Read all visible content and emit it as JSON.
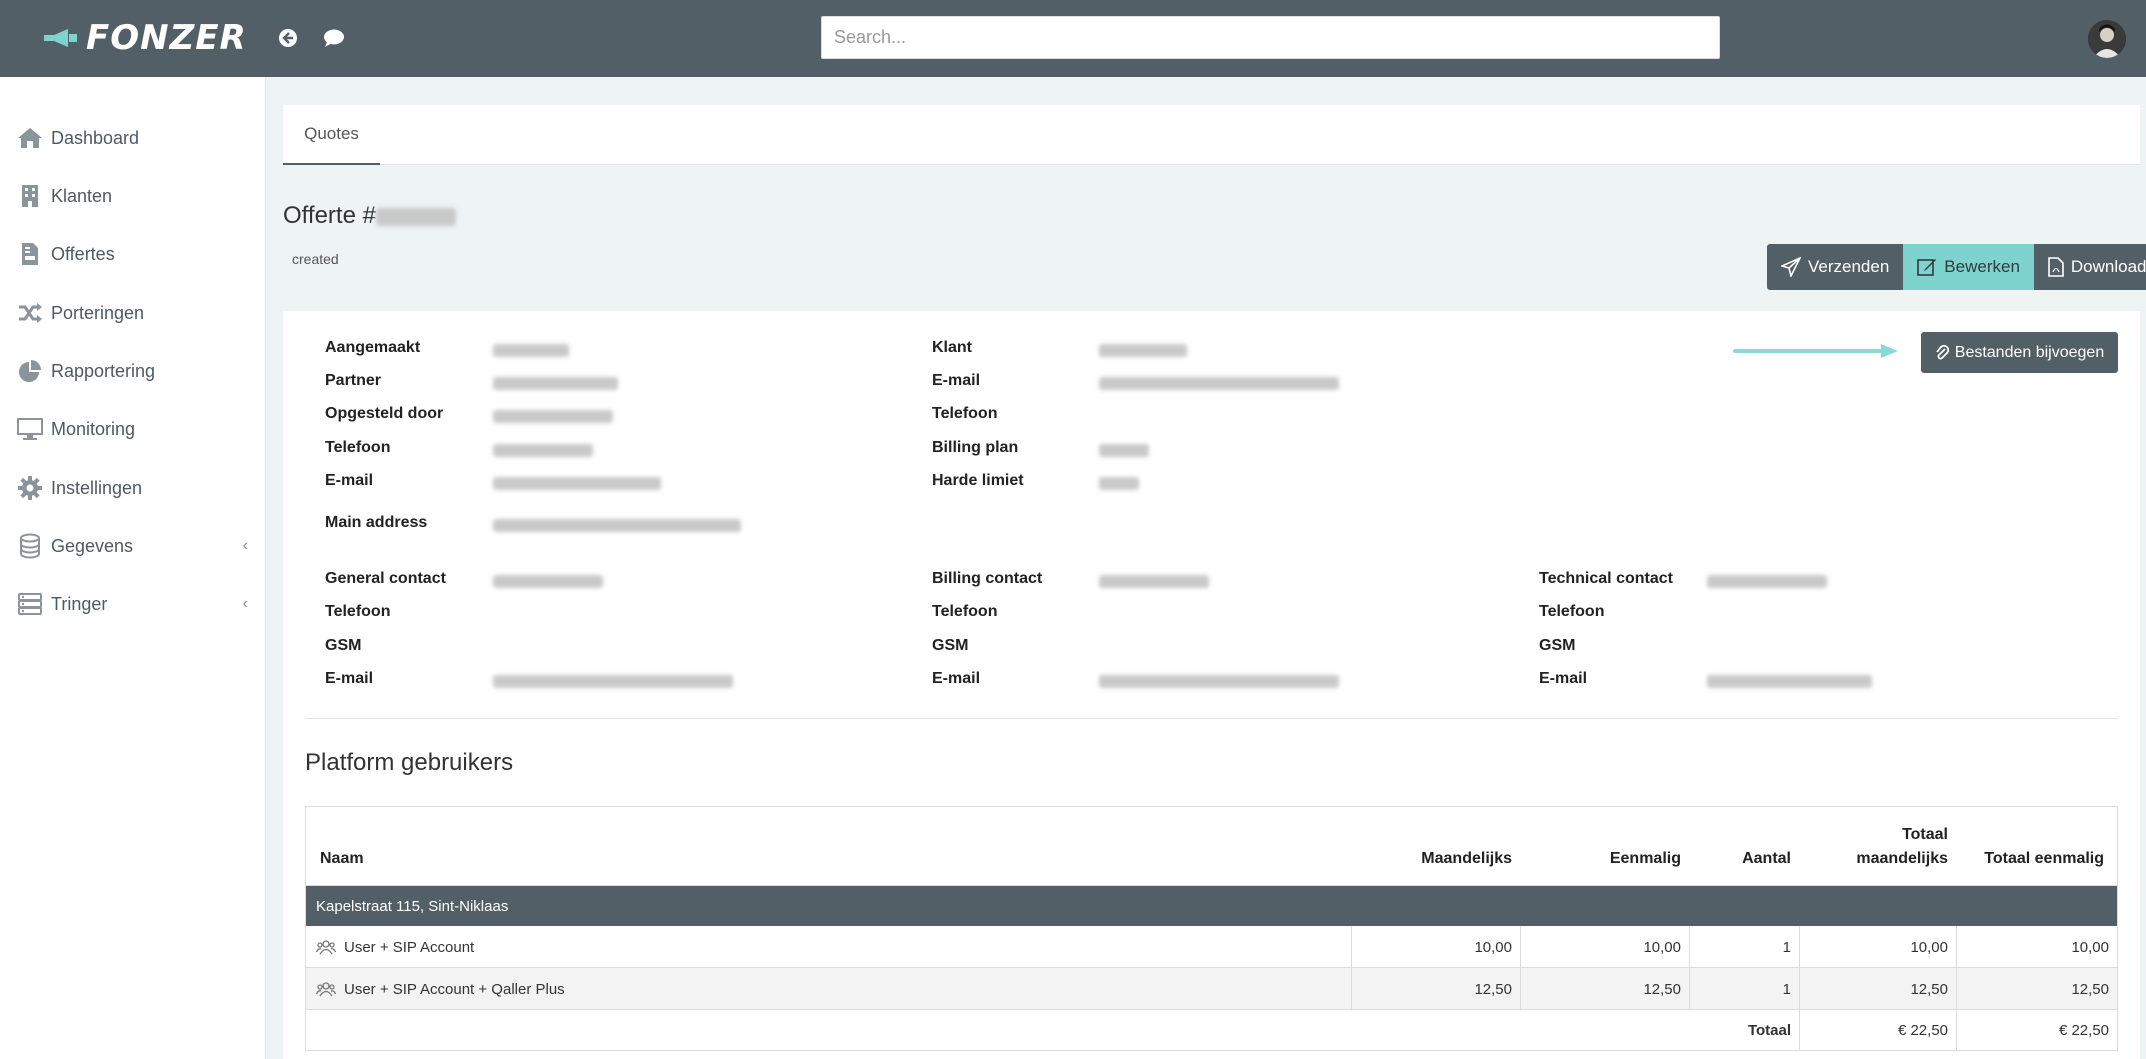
{
  "header": {
    "logo_text": "FONZER",
    "search_placeholder": "Search..."
  },
  "sidebar": {
    "items": [
      {
        "label": "Dashboard",
        "icon": "home-icon"
      },
      {
        "label": "Klanten",
        "icon": "building-icon"
      },
      {
        "label": "Offertes",
        "icon": "file-invoice-icon"
      },
      {
        "label": "Porteringen",
        "icon": "shuffle-icon"
      },
      {
        "label": "Rapportering",
        "icon": "pie-chart-icon"
      },
      {
        "label": "Monitoring",
        "icon": "monitor-icon"
      },
      {
        "label": "Instellingen",
        "icon": "gear-icon"
      },
      {
        "label": "Gegevens",
        "icon": "database-icon"
      },
      {
        "label": "Tringer",
        "icon": "server-icon"
      }
    ]
  },
  "tabs": [
    {
      "label": "Quotes"
    }
  ],
  "quote": {
    "title_prefix": "Offerte #",
    "status": "created"
  },
  "actions": {
    "send": "Verzenden",
    "edit": "Bewerken",
    "download": "Download",
    "attach": "Bestanden bijvoegen"
  },
  "details": {
    "col1": [
      "Aangemaakt",
      "Partner",
      "Opgesteld door",
      "Telefoon",
      "E-mail"
    ],
    "main_address": "Main address",
    "col2": [
      "Klant",
      "E-mail",
      "Telefoon",
      "Billing plan",
      "Harde limiet"
    ]
  },
  "contacts": [
    {
      "title": "General contact",
      "fields": [
        "Telefoon",
        "GSM",
        "E-mail"
      ]
    },
    {
      "title": "Billing contact",
      "fields": [
        "Telefoon",
        "GSM",
        "E-mail"
      ]
    },
    {
      "title": "Technical contact",
      "fields": [
        "Telefoon",
        "GSM",
        "E-mail"
      ]
    }
  ],
  "platform": {
    "title": "Platform gebruikers",
    "columns": {
      "naam": "Naam",
      "maandelijks": "Maandelijks",
      "eenmalig": "Eenmalig",
      "aantal": "Aantal",
      "totaal_maandelijks_1": "Totaal",
      "totaal_maandelijks_2": "maandelijks",
      "totaal_eenmalig": "Totaal eenmalig"
    },
    "group": "Kapelstraat 115, Sint-Niklaas",
    "rows": [
      {
        "name": "User + SIP Account",
        "maandelijks": "10,00",
        "eenmalig": "10,00",
        "aantal": "1",
        "totaal_maandelijks": "10,00",
        "totaal_eenmalig": "10,00"
      },
      {
        "name": "User + SIP Account + Qaller Plus",
        "maandelijks": "12,50",
        "eenmalig": "12,50",
        "aantal": "1",
        "totaal_maandelijks": "12,50",
        "totaal_eenmalig": "12,50"
      }
    ],
    "total_label": "Totaal",
    "total_maandelijks": "€ 22,50",
    "total_eenmalig": "€ 22,50"
  },
  "colors": {
    "topbar": "#535f66",
    "accent": "#7fd3cf"
  }
}
